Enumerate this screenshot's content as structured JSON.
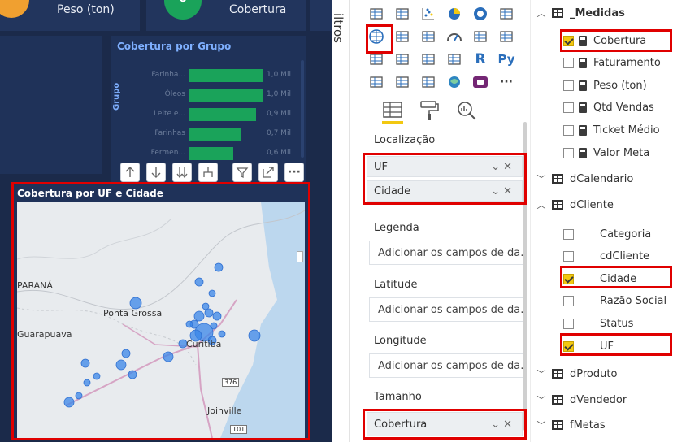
{
  "canvas": {
    "kpis": [
      {
        "label": "Peso (ton)",
        "icon_color": "#f0a030"
      },
      {
        "label": "Cobertura",
        "icon_color": "#1aa35a"
      }
    ],
    "bar_chart": {
      "title": "Cobertura por Grupo",
      "y_axis_label": "Grupo",
      "bar_color": "#1aa35a"
    },
    "map": {
      "title": "Cobertura por UF e Cidade",
      "labels": {
        "parana": "PARANÁ",
        "ponta_grossa": "Ponta Grossa",
        "guarapuava": "Guarapuava",
        "curitiba": "Curitiba",
        "joinville": "Joinville",
        "road_376": "376",
        "road_101": "101"
      },
      "bubble_color": "#3a86e8"
    }
  },
  "chart_data": {
    "type": "bar",
    "title": "Cobertura por Grupo",
    "ylabel": "Grupo",
    "categories": [
      "Farinha...",
      "Óleos",
      "Leite e...",
      "Farinhas",
      "Fermen..."
    ],
    "values": [
      1.0,
      1.0,
      0.9,
      0.7,
      0.6
    ],
    "value_labels": [
      "1,0 Mil",
      "1,0 Mil",
      "0,9 Mil",
      "0,7 Mil",
      "0,6 Mil"
    ],
    "xlim": [
      0,
      1.0
    ]
  },
  "viz_pane": {
    "side_label": "iltros",
    "wells": {
      "localizacao": {
        "label": "Localização",
        "fields": [
          "UF",
          "Cidade"
        ]
      },
      "legenda": {
        "label": "Legenda",
        "placeholder": "Adicionar os campos de da..."
      },
      "latitude": {
        "label": "Latitude",
        "placeholder": "Adicionar os campos de da..."
      },
      "longitude": {
        "label": "Longitude",
        "placeholder": "Adicionar os campos de da..."
      },
      "tamanho": {
        "label": "Tamanho",
        "fields": [
          "Cobertura"
        ]
      }
    },
    "more": "···",
    "r_label": "R",
    "py_label": "Py"
  },
  "fields_pane": {
    "tables": [
      {
        "name": "_Medidas",
        "expanded": true
      },
      {
        "name": "dCalendario",
        "expanded": false
      },
      {
        "name": "dCliente",
        "expanded": true
      },
      {
        "name": "dProduto",
        "expanded": false
      },
      {
        "name": "dVendedor",
        "expanded": false
      },
      {
        "name": "fMetas",
        "expanded": false
      }
    ],
    "medidas": [
      {
        "name": "Cobertura",
        "checked": true
      },
      {
        "name": "Faturamento",
        "checked": false
      },
      {
        "name": "Peso (ton)",
        "checked": false
      },
      {
        "name": "Qtd Vendas",
        "checked": false
      },
      {
        "name": "Ticket Médio",
        "checked": false
      },
      {
        "name": "Valor Meta",
        "checked": false
      }
    ],
    "cliente": [
      {
        "name": "Categoria",
        "checked": false
      },
      {
        "name": "cdCliente",
        "checked": false
      },
      {
        "name": "Cidade",
        "checked": true
      },
      {
        "name": "Razão Social",
        "checked": false
      },
      {
        "name": "Status",
        "checked": false
      },
      {
        "name": "UF",
        "checked": true
      }
    ]
  }
}
